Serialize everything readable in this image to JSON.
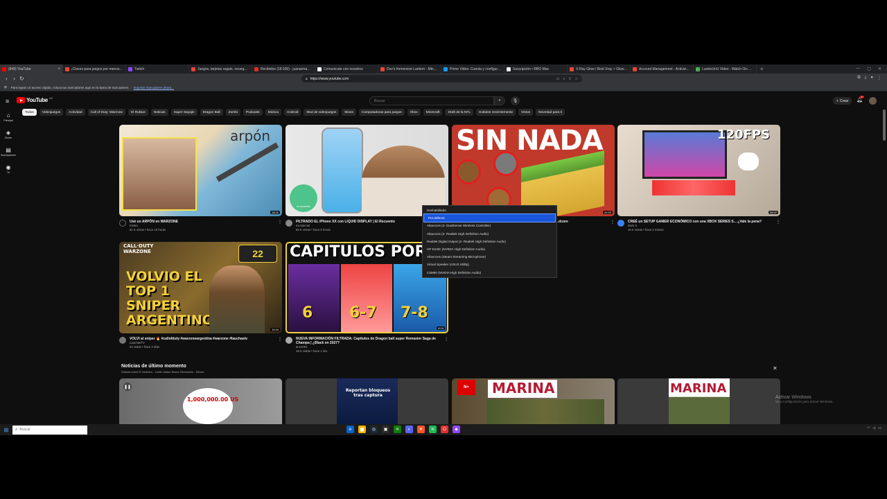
{
  "browser": {
    "tabs": [
      {
        "title": "(849) YouTube",
        "color": "#ff0000",
        "active": true
      },
      {
        "title": "¡Claves para juegos por menos de 5...",
        "color": "#e8443a"
      },
      {
        "title": "Twitch",
        "color": "#9146ff"
      },
      {
        "title": "Juegos, tarjetas regalo, recargas y m...",
        "color": "#e8443a"
      },
      {
        "title": "Recibidos (18.930) - juanarmando@...",
        "color": "#d93025"
      },
      {
        "title": "Comunicate con nosotros",
        "color": "#f5f5f5"
      },
      {
        "title": "Dov's Immersive Lantern - Minecraf...",
        "color": "#e8443a"
      },
      {
        "title": "Prime Video: Cuenta y configuración",
        "color": "#1a98ff"
      },
      {
        "title": "Suscripción • RBO Max",
        "color": "#eeeeee"
      },
      {
        "title": "X-Ray Glow | Best Xray + Glowing O...",
        "color": "#e8443a"
      },
      {
        "title": "Account Management - Activision®",
        "color": "#e8443a"
      },
      {
        "title": "LuisitoUnU Video - Watch On-Dem...",
        "color": "#4caf50"
      }
    ],
    "new_tab_label": "+",
    "url": "https://www.youtube.com",
    "bookmarks_text": "Para lograr un acceso rápido, coloca tus marcadores aquí en la barra de marcadores.",
    "bookmarks_link": "Importar marcadores ahora..."
  },
  "youtube": {
    "logo_text": "YouTube",
    "logo_country": "MX",
    "search_placeholder": "Buscar",
    "create_label": "Crear",
    "notif_count": "9+",
    "sidebar": [
      {
        "icon": "⌂",
        "label": "Principal"
      },
      {
        "icon": "◈",
        "label": "Shorts"
      },
      {
        "icon": "▤",
        "label": "Suscripciones"
      },
      {
        "icon": "◉",
        "label": "Tú"
      }
    ],
    "chips": [
      "Todos",
      "Videojuegos",
      "Actividad",
      "Call of Duty: Warzone",
      "El Rubius",
      "Noticias",
      "Super Sayajin",
      "Dragon Ball",
      "Zombi",
      "Podcasts",
      "Música",
      "Android",
      "Mod de videojuegos",
      "Mixes",
      "Computadoras para juegos",
      "Xbox",
      "Minecraft",
      "Draft de la NFL",
      "Subidos recientemente",
      "Vistos",
      "Novedad para ti"
    ],
    "videos": [
      {
        "title": "Usé un ARPÓN en WARZONE",
        "channel": "Kesko",
        "stats": "81 K vistas • hace 10 horas",
        "duration": "18:31",
        "thumb_text": "arpón"
      },
      {
        "title": "FILTRADO EL iPhone XX con LIQUID DISPLAY | El Recuento",
        "channel": "Ira Marcial",
        "stats": "83 K vistas • hace 6 horas",
        "duration": "",
        "thumb_text": "el recuento"
      },
      {
        "title": "Como pasar Minecraft SIN NADA en Hardcore",
        "channel": "",
        "stats": "",
        "duration": "41:53",
        "thumb_text": "SIN NADA"
      },
      {
        "title": "CREÉ un SETUP GAMER ECONÓMICO con una XBOX SERIES S... ¿Vale la pena?",
        "channel": "Dark X",
        "stats": "16 K vistas • hace 2 meses",
        "duration": "26:47",
        "thumb_text": "120FPS"
      },
      {
        "title": "VOLVI al sniper 🔥 #callofduty #warzoneargentina #warzone #lauchastv",
        "channel": "LauchasTV",
        "stats": "51 vistas • hace 2 días",
        "duration": "10:34",
        "thumb_text": "VOLVIO EL TOP 1 SNIPER ARGENTINO"
      },
      {
        "title": "NUEVA INFORMACIÓN FILTRADA: Capitulos de Dragon ball super Remaster Saga de Champa | ¿Black en 2027?",
        "channel": "anco061",
        "stats": "18 K vistas • hace 1 día",
        "duration": "8:16",
        "thumb_text": "CAPITULOS POR SA"
      }
    ],
    "dropdown": [
      "Deshabilitado",
      "Por defecto",
      "Altavoces (2- DualSense Wireless Controller)",
      "Altavoces (2- Realtek High Definition Audio)",
      "Realtek Digital Output (2- Realtek High Definition Audio)",
      "HP E240c (NVIDIA High Definition Audio)",
      "Altavoces (Steam Streaming Microphone)",
      "Virtual Speaker (ASUS Utility)",
      "C6M60 (NVIDIA High Definition Audio)"
    ],
    "dropdown_selected_index": 1,
    "news": {
      "title": "Noticias de último momento",
      "subtitle": "Noticias sobre El Jardinero - Cartel Jalisco Nueva Generación - México",
      "thumbs": [
        "1,000,000.00 US",
        "Reportan bloqueos tras captura",
        "MARINA",
        "MARINA"
      ]
    }
  },
  "windows": {
    "activate_title": "Activar Windows",
    "activate_sub": "Ve a Configuración para activar Windows.",
    "taskbar_search_placeholder": "Buscar"
  }
}
